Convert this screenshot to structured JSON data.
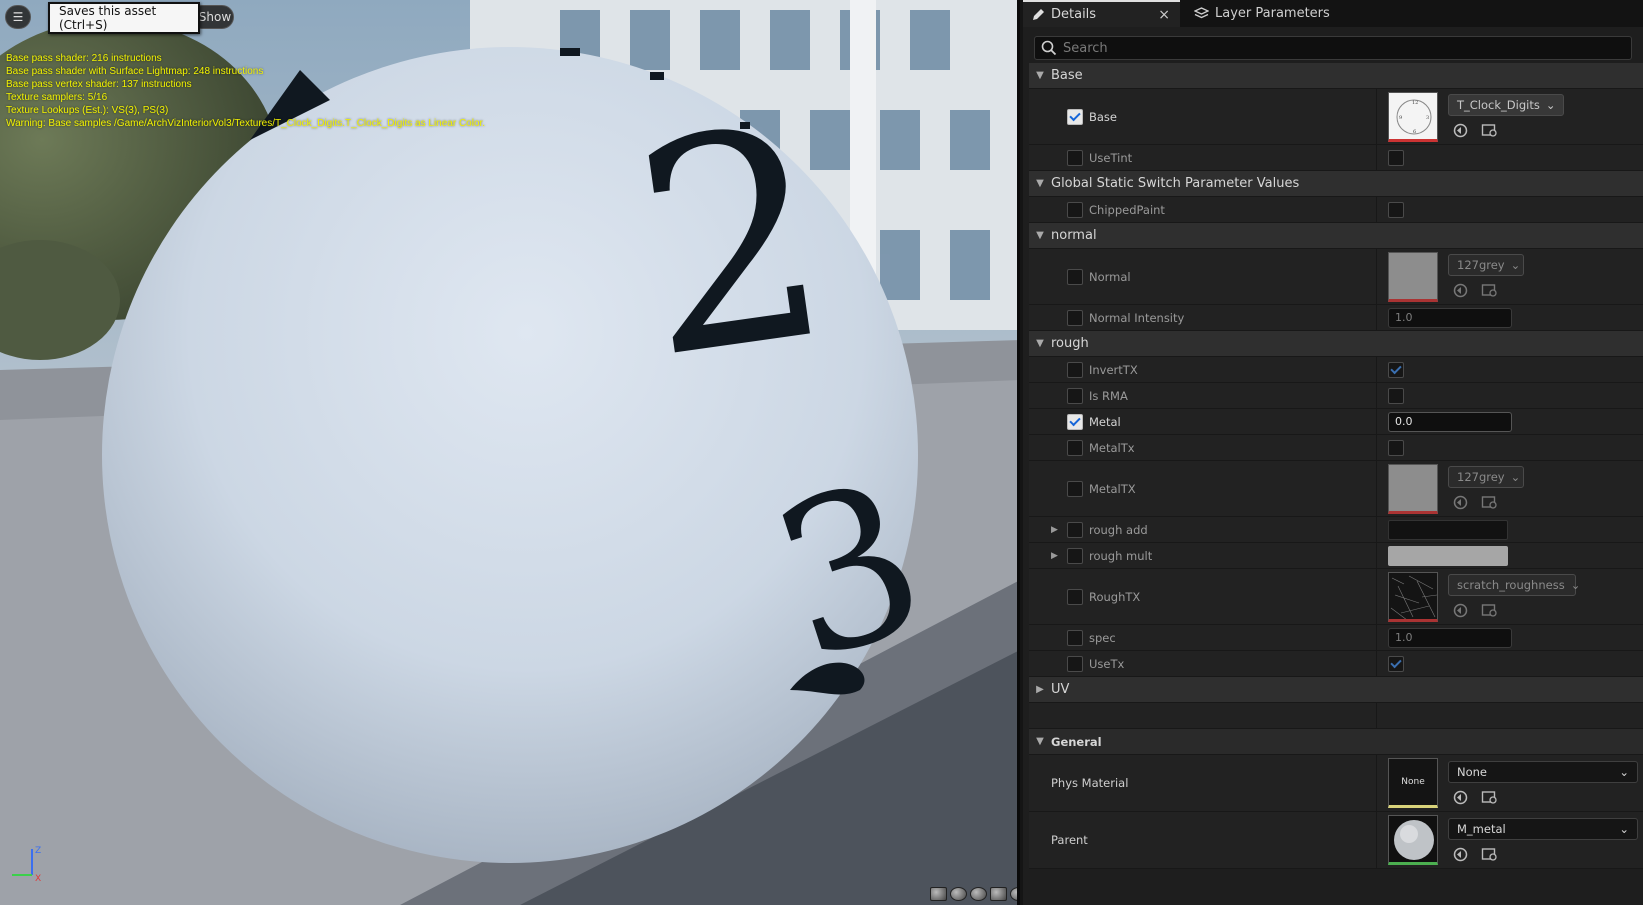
{
  "viewport": {
    "menu_icon": "hamburger-icon",
    "show_label": "Show",
    "tooltip": "Saves this asset (Ctrl+S)",
    "stats": [
      "Base pass shader: 216 instructions",
      "Base pass shader with Surface Lightmap: 248 instructions",
      "Base pass vertex shader: 137 instructions",
      "Texture samplers: 5/16",
      "Texture Lookups (Est.): VS(3), PS(3)",
      "Warning: Base samples /Game/ArchVizInteriorVol3/Textures/T_Clock_Digits.T_Clock_Digits as Linear Color."
    ],
    "axis": {
      "z": "Z",
      "x": "X"
    },
    "sphere_digits": [
      "2",
      "3"
    ]
  },
  "tabs": {
    "details": "Details",
    "layers": "Layer Parameters",
    "close": "×"
  },
  "search": {
    "placeholder": "Search"
  },
  "categories": {
    "base": "Base",
    "static_switch": "Global Static Switch Parameter Values",
    "normal": "normal",
    "rough": "rough",
    "uv": "UV",
    "general": "General"
  },
  "params": {
    "base": {
      "label": "Base",
      "asset": "T_Clock_Digits",
      "checked": true
    },
    "usetint": {
      "label": "UseTint",
      "checked": false,
      "value": false
    },
    "chippedpaint": {
      "label": "ChippedPaint",
      "checked": false,
      "value": false
    },
    "normal": {
      "label": "Normal",
      "asset": "127grey",
      "checked": false
    },
    "normal_intensity": {
      "label": "Normal Intensity",
      "value": "1.0",
      "checked": false
    },
    "inverttx": {
      "label": "InvertTX",
      "checked": false,
      "value": true
    },
    "isrma": {
      "label": "Is RMA",
      "checked": false,
      "value": false
    },
    "metal": {
      "label": "Metal",
      "value": "0.0",
      "checked": true
    },
    "metaltx_switch": {
      "label": "MetalTx",
      "checked": false,
      "value": false
    },
    "metaltx": {
      "label": "MetalTX",
      "asset": "127grey",
      "checked": false
    },
    "rough_add": {
      "label": "rough add",
      "checked": false
    },
    "rough_mult": {
      "label": "rough mult",
      "checked": false
    },
    "roughtx": {
      "label": "RoughTX",
      "asset": "scratch_roughness",
      "checked": false
    },
    "spec": {
      "label": "spec",
      "value": "1.0",
      "checked": false
    },
    "usetx": {
      "label": "UseTx",
      "checked": false,
      "value": true
    }
  },
  "general": {
    "phys_material": {
      "label": "Phys Material",
      "thumb_text": "None",
      "value": "None"
    },
    "parent": {
      "label": "Parent",
      "value": "M_metal"
    }
  },
  "colors": {
    "accent": "#1565d8",
    "stats_text": "#f2f200",
    "panel_bg": "#1e1e1e"
  }
}
